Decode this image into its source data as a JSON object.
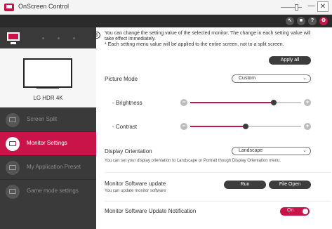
{
  "window": {
    "title": "OnScreen Control",
    "min_glyph": "—",
    "close_glyph": "✕"
  },
  "toolbar": {
    "buttons": [
      {
        "icon": "pointer-icon",
        "glyph": "↖"
      },
      {
        "icon": "monitor-icon",
        "glyph": "■"
      },
      {
        "icon": "help-icon",
        "glyph": "?"
      },
      {
        "icon": "settings-icon",
        "glyph": "⚙"
      }
    ]
  },
  "sidebar": {
    "monitor_name": "LG HDR 4K",
    "items": [
      {
        "label": "Screen Split",
        "icon": "screen-split-icon"
      },
      {
        "label": "Monitor Settings",
        "icon": "monitor-settings-icon",
        "active": true
      },
      {
        "label": "My Application Preset",
        "icon": "app-preset-icon"
      },
      {
        "label": "Game mode settings",
        "icon": "gamepad-icon"
      }
    ]
  },
  "info": {
    "icon_glyph": "i",
    "lines": [
      "You can change the setting value of the selected monitor. The change in each setting value will",
      "take effect immediately.",
      "* Each setting menu value will be applied to the entire screen, not to a split screen."
    ],
    "apply_all": "Apply all"
  },
  "picture_mode": {
    "label": "Picture Mode",
    "value": "Custom"
  },
  "brightness": {
    "label": "- Brightness",
    "level": 0.75
  },
  "contrast": {
    "label": "- Contrast",
    "level": 0.5
  },
  "slider_glyphs": {
    "minus": "−",
    "plus": "+"
  },
  "orientation": {
    "label": "Display Orientation",
    "value": "Landscape",
    "hint": "You can set your display orientation to Landscape or Portrait though Display Orientation menu."
  },
  "software_update": {
    "label": "Monitor Software update",
    "hint": "You can update monitor software",
    "run": "Run",
    "file_open": "File Open"
  },
  "notification": {
    "label": "Monitor Software Update Notification",
    "toggle": "On"
  },
  "chevron_glyph": "⌄",
  "colors": {
    "accent": "#c81449",
    "sidebar_bg": "#3a3a3a",
    "toolbar_bg": "#2b2b2b",
    "button_dark": "#3d3d3d"
  }
}
